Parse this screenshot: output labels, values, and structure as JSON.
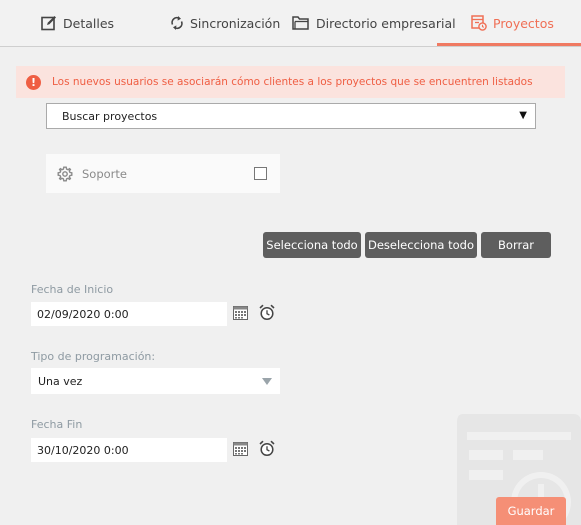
{
  "tabs": {
    "details": "Detalles",
    "sync": "Sincronización",
    "directory": "Directorio empresarial",
    "projects": "Proyectos"
  },
  "alert": {
    "text": "Los nuevos usuarios se asociarán cómo clientes a los proyectos que se encuentren listados",
    "icon": "exclamation-icon"
  },
  "project_search": {
    "value": "Buscar proyectos"
  },
  "projects": [
    {
      "name": "Soporte",
      "checked": false,
      "icon": "gear-icon"
    }
  ],
  "actions": {
    "select_all": "Selecciona todo",
    "deselect_all": "Deselecciona todo",
    "clear": "Borrar"
  },
  "form": {
    "start_label": "Fecha de Inicio",
    "start_value": "02/09/2020 0:00",
    "schedule_label": "Tipo de programación:",
    "schedule_value": "Una vez",
    "end_label": "Fecha Fin",
    "end_value": "30/10/2020 0:00"
  },
  "save_label": "Guardar",
  "colors": {
    "accent": "#f07a62",
    "alert_bg": "#fbe3de",
    "alert_text": "#ef5e43",
    "button_dark": "#5e5e5e",
    "save_button": "#f58f76"
  }
}
